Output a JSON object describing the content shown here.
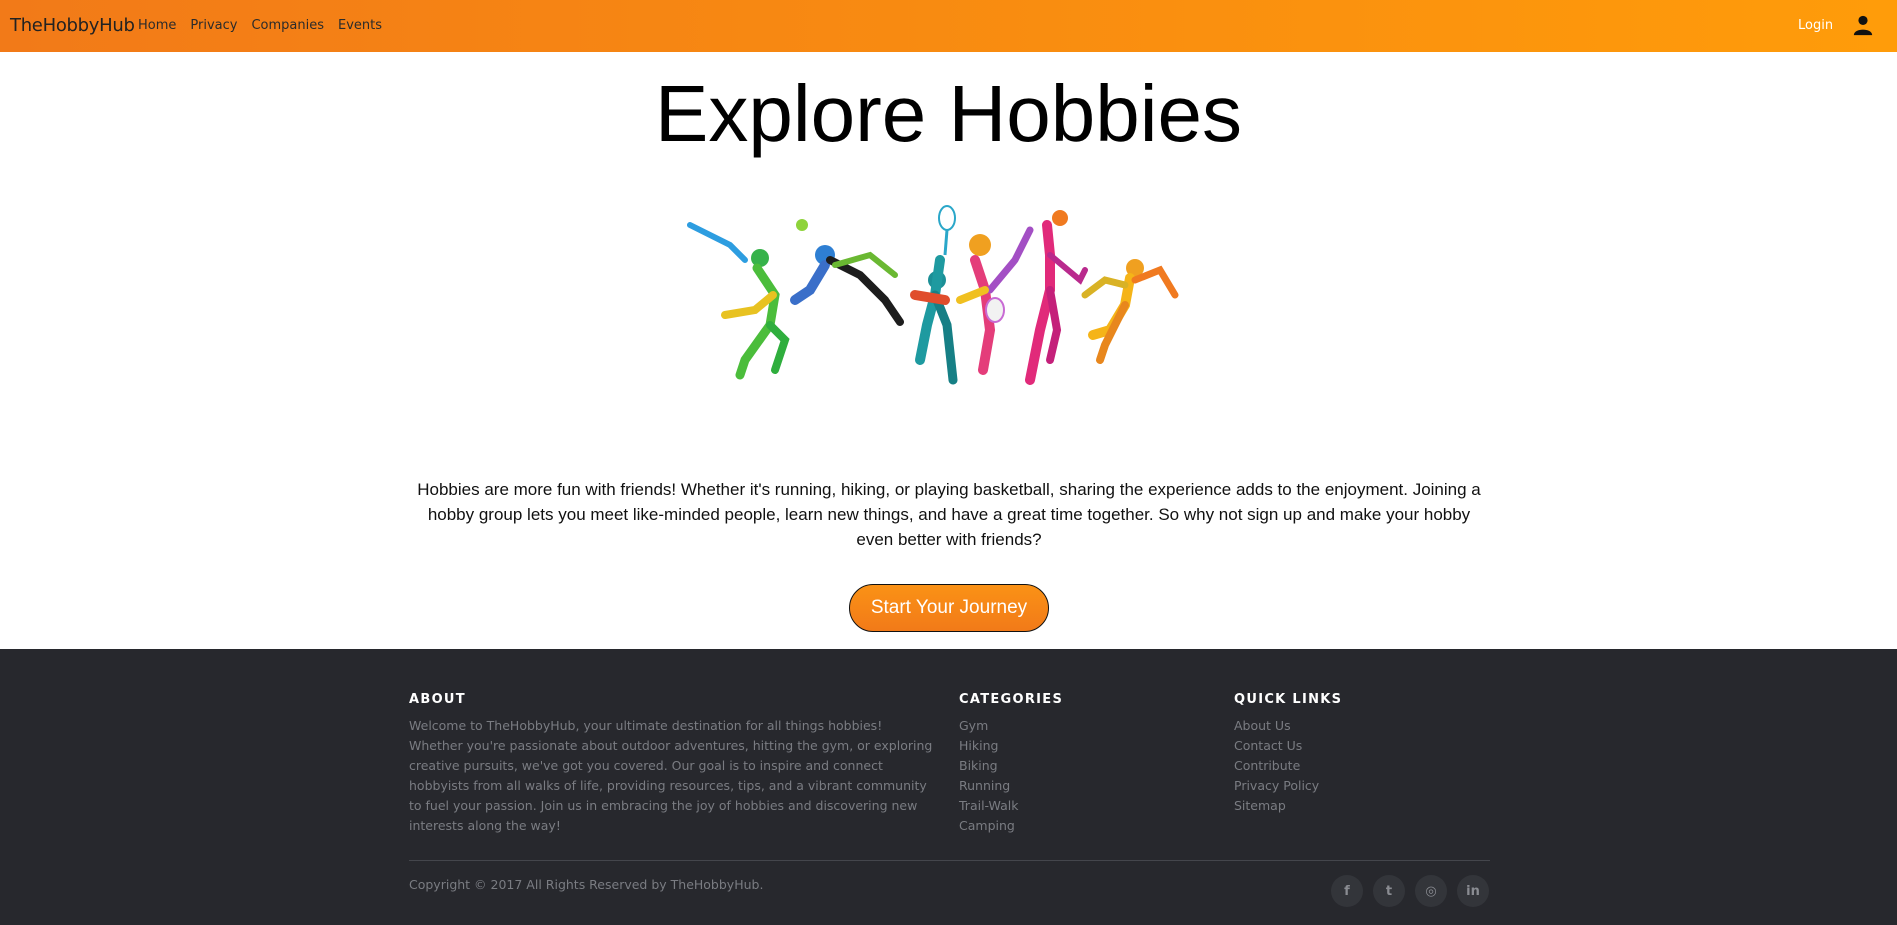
{
  "navbar": {
    "brand": "TheHobbyHub",
    "links": [
      "Home",
      "Privacy",
      "Companies",
      "Events"
    ],
    "login_label": "Login"
  },
  "hero": {
    "title": "Explore Hobbies",
    "intro": "Hobbies are more fun with friends! Whether it's running, hiking, or playing basketball, sharing the experience adds to the enjoyment. Joining a hobby group lets you meet like-minded people, learn new things, and have a great time together. So why not sign up and make your hobby even better with friends?",
    "cta_label": "Start Your Journey"
  },
  "footer": {
    "about": {
      "heading": "ABOUT",
      "text": "Welcome to TheHobbyHub, your ultimate destination for all things hobbies! Whether you're passionate about outdoor adventures, hitting the gym, or exploring creative pursuits, we've got you covered. Our goal is to inspire and connect hobbyists from all walks of life, providing resources, tips, and a vibrant community to fuel your passion. Join us in embracing the joy of hobbies and discovering new interests along the way!"
    },
    "categories": {
      "heading": "CATEGORIES",
      "items": [
        "Gym",
        "Hiking",
        "Biking",
        "Running",
        "Trail-Walk",
        "Camping"
      ]
    },
    "quick_links": {
      "heading": "QUICK LINKS",
      "items": [
        "About Us",
        "Contact Us",
        "Contribute",
        "Privacy Policy",
        "Sitemap"
      ]
    },
    "copyright": "Copyright © 2017 All Rights Reserved by TheHobbyHub.",
    "socials": [
      {
        "icon": "facebook-icon",
        "glyph": "f"
      },
      {
        "icon": "twitter-icon",
        "glyph": "t"
      },
      {
        "icon": "dribbble-icon",
        "glyph": "◎"
      },
      {
        "icon": "linkedin-icon",
        "glyph": "in"
      }
    ]
  },
  "colors": {
    "nav_gradient_start": "#f27a18",
    "nav_gradient_end": "#ff9c0a",
    "footer_bg": "#27282d",
    "cta_bg": "#f98d10"
  }
}
